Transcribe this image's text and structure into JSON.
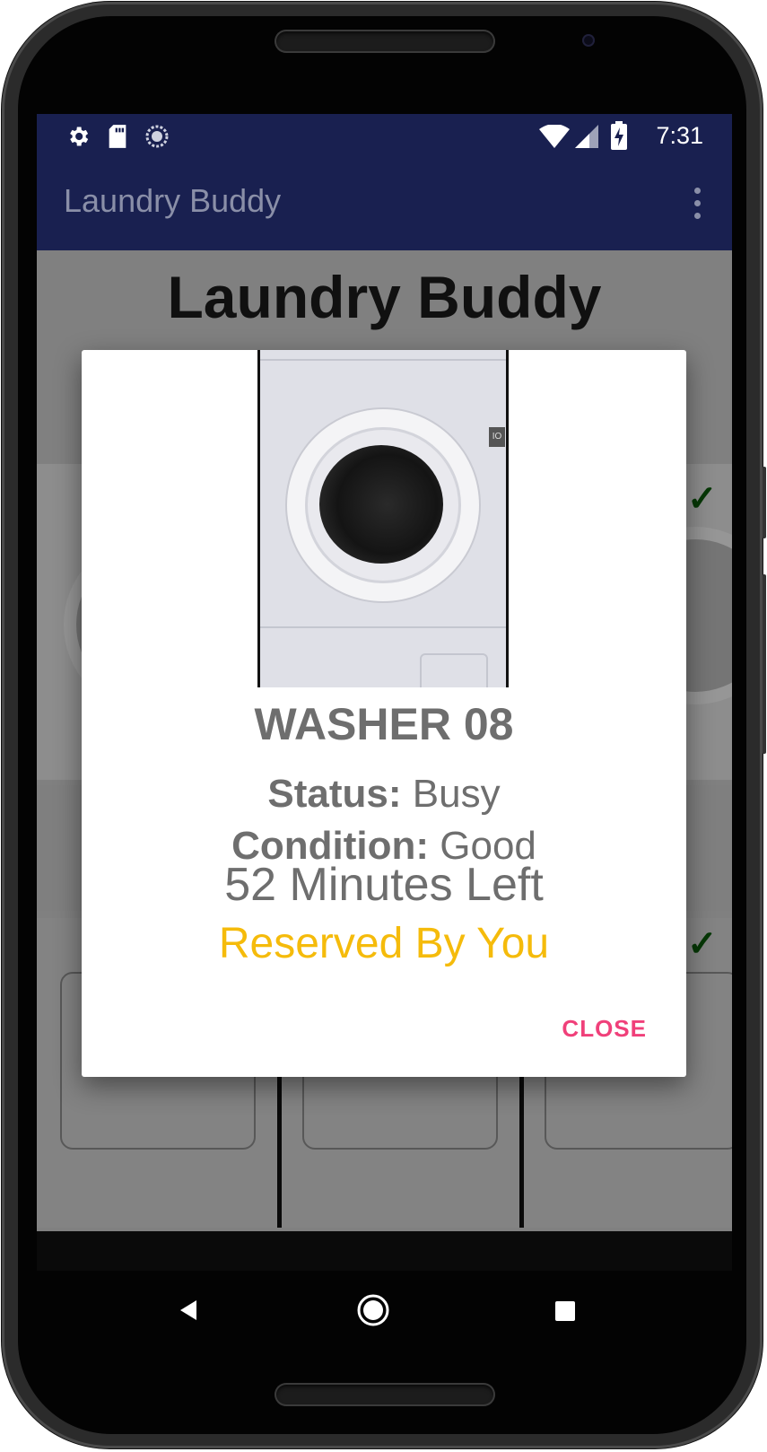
{
  "status_bar": {
    "time": "7:31",
    "left_icons": [
      "gear-icon",
      "sd-card-icon",
      "sync-icon"
    ],
    "right_icons": [
      "wifi-icon",
      "signal-icon",
      "battery-charging-icon"
    ]
  },
  "app_bar": {
    "title": "Laundry Buddy",
    "menu_icon": "overflow-menu-icon"
  },
  "page": {
    "title": "Laundry Buddy"
  },
  "dialog": {
    "machine_name": "WASHER 08",
    "status_label": "Status:",
    "status_value": "Busy",
    "condition_label": "Condition:",
    "condition_value": "Good",
    "time_left": "52 Minutes Left",
    "reservation": "Reserved By You",
    "close_label": "CLOSE",
    "colors": {
      "reservation": "#f5bb0b",
      "close": "#f0407a"
    }
  },
  "nav_bar": {
    "buttons": [
      "back-icon",
      "home-icon",
      "recents-icon"
    ]
  },
  "colors": {
    "app_bar": "#192050"
  }
}
